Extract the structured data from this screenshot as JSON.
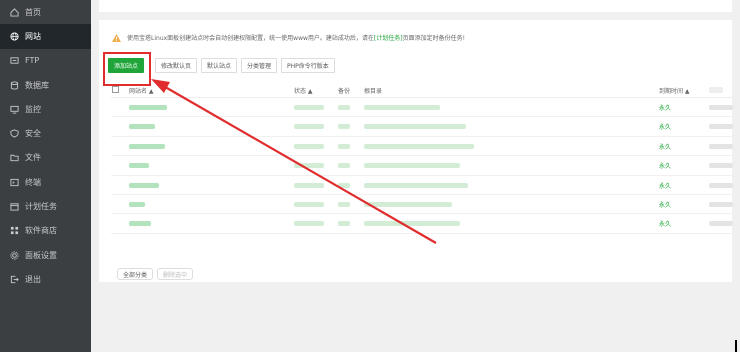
{
  "sidebar": {
    "items": [
      {
        "label": "首页",
        "icon": "home-icon",
        "active": false
      },
      {
        "label": "网站",
        "icon": "globe-icon",
        "active": true
      },
      {
        "label": "FTP",
        "icon": "ftp-icon",
        "active": false
      },
      {
        "label": "数据库",
        "icon": "database-icon",
        "active": false
      },
      {
        "label": "监控",
        "icon": "monitor-icon",
        "active": false
      },
      {
        "label": "安全",
        "icon": "shield-icon",
        "active": false
      },
      {
        "label": "文件",
        "icon": "folder-icon",
        "active": false
      },
      {
        "label": "终端",
        "icon": "terminal-icon",
        "active": false
      },
      {
        "label": "计划任务",
        "icon": "calendar-icon",
        "active": false
      },
      {
        "label": "软件商店",
        "icon": "grid-icon",
        "active": false
      },
      {
        "label": "面板设置",
        "icon": "gear-icon",
        "active": false
      },
      {
        "label": "退出",
        "icon": "logout-icon",
        "active": false
      }
    ]
  },
  "notice": {
    "text_before": "使用宝塔Linux面板创建站点时会自动创建权限配置，统一使用www用户。建站成功后，请在",
    "link": "[计划任务]",
    "text_after": "页面添加定时备份任务!"
  },
  "toolbar": {
    "add_site": "添加站点",
    "modify_default_page": "修改默认页",
    "default_site": "默认站点",
    "category_manage": "分类管理",
    "php_cli_version": "PHP命令行版本"
  },
  "table": {
    "headers": {
      "site_name": "网站名 ▲",
      "status": "状态 ▲",
      "backup": "备份",
      "root_dir": "根目录",
      "expire": "到期时间 ▲"
    },
    "rows": [
      {
        "expire": "永久"
      },
      {
        "expire": "永久"
      },
      {
        "expire": "永久"
      },
      {
        "expire": "永久"
      },
      {
        "expire": "永久"
      },
      {
        "expire": "永久"
      },
      {
        "expire": "永久"
      }
    ]
  },
  "footer": {
    "all_categories": "全部分类",
    "batch_ops": "删除选中"
  },
  "colors": {
    "sidebar_bg": "#3b3f42",
    "sidebar_active": "#22272b",
    "accent_green": "#20a53a",
    "annotation_red": "#e02c2c"
  }
}
